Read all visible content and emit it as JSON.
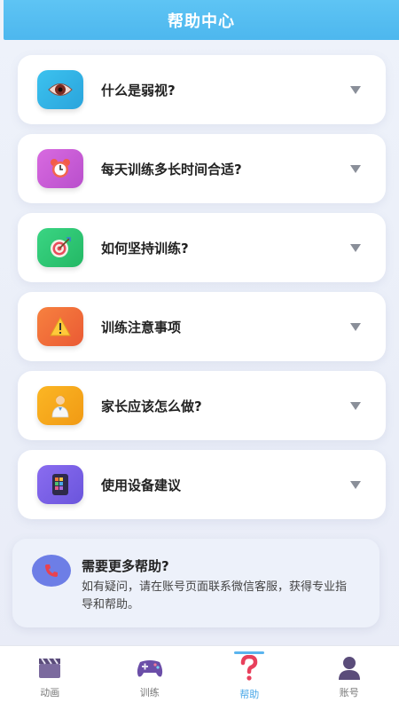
{
  "header": {
    "title": "帮助中心"
  },
  "faq": [
    {
      "label": "什么是弱视?",
      "icon": "eye-icon",
      "color": "#2fb4e6"
    },
    {
      "label": "每天训练多长时间合适?",
      "icon": "alarm-clock-icon",
      "color": "#c65cd6"
    },
    {
      "label": "如何坚持训练?",
      "icon": "target-icon",
      "color": "#2ecb73"
    },
    {
      "label": "训练注意事项",
      "icon": "warning-icon",
      "color": "#f06a3a"
    },
    {
      "label": "家长应该怎么做?",
      "icon": "parent-icon",
      "color": "#f6a91d"
    },
    {
      "label": "使用设备建议",
      "icon": "tablet-icon",
      "color": "#7b63e8"
    }
  ],
  "help": {
    "title": "需要更多帮助?",
    "text": "如有疑问，请在账号页面联系微信客服，获得专业指导和帮助。",
    "icon": "phone-icon"
  },
  "tabs": [
    {
      "label": "动画",
      "icon": "clapperboard-icon",
      "active": false
    },
    {
      "label": "训练",
      "icon": "gamepad-icon",
      "active": false
    },
    {
      "label": "帮助",
      "icon": "question-icon",
      "active": true
    },
    {
      "label": "账号",
      "icon": "user-icon",
      "active": false
    }
  ],
  "colors": {
    "accent": "#4db7ee",
    "active_tab": "#4aa8e8"
  }
}
